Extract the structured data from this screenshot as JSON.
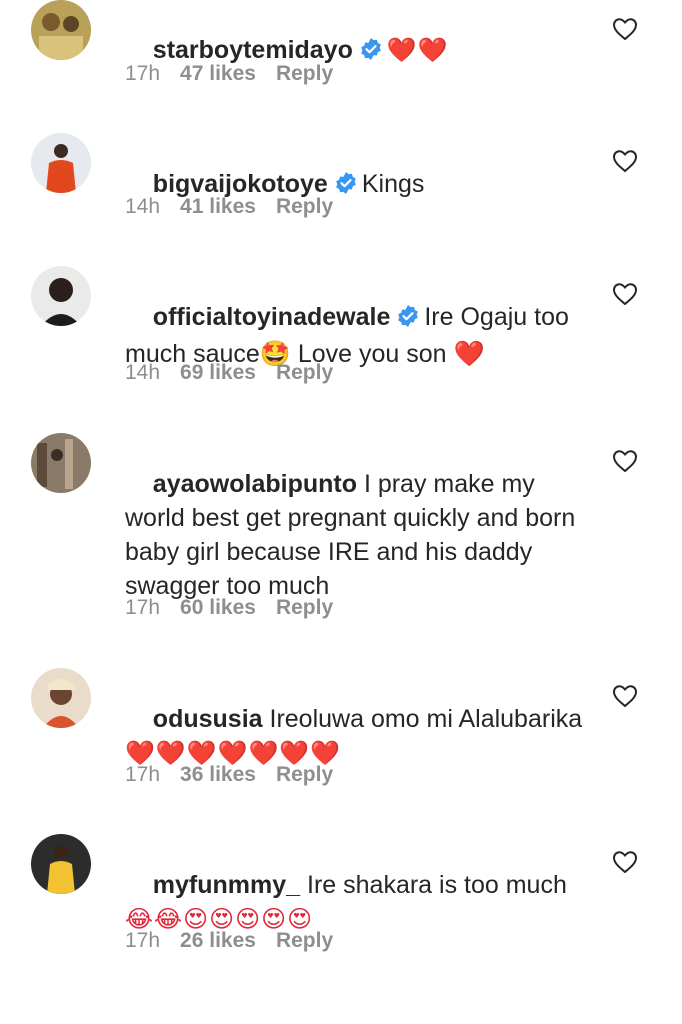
{
  "comments": [
    {
      "username": "starboytemidayo",
      "verified": true,
      "text": "",
      "emoji": "❤️❤️",
      "time": "17h",
      "likes": "47 likes",
      "reply": "Reply",
      "avatar_color": "#b9a15a"
    },
    {
      "username": "bigvaijokotoye",
      "verified": true,
      "text": "Kings",
      "emoji": "",
      "time": "14h",
      "likes": "41 likes",
      "reply": "Reply",
      "avatar_color": "#e6e9ee"
    },
    {
      "username": "officialtoyinadewale",
      "verified": true,
      "text": "Ire Ogaju too much sauce🤩 Love you son ❤️",
      "emoji": "",
      "time": "14h",
      "likes": "69 likes",
      "reply": "Reply",
      "avatar_color": "#2a2a2a"
    },
    {
      "username": "ayaowolabipunto",
      "verified": false,
      "text": "I pray make my world best get pregnant quickly and born baby girl because IRE and his daddy swagger too much",
      "emoji": "",
      "time": "17h",
      "likes": "60 likes",
      "reply": "Reply",
      "avatar_color": "#8a7a68"
    },
    {
      "username": "odususia",
      "verified": false,
      "text": "Ireoluwa omo mi Alalubarika",
      "emoji": "❤️❤️❤️❤️❤️❤️❤️",
      "time": "17h",
      "likes": "36 likes",
      "reply": "Reply",
      "avatar_color": "#e9dccb"
    },
    {
      "username": "myfunmmy_",
      "verified": false,
      "text": "Ire shakara is too much",
      "emoji": "😂😂😍😍😍😍😍",
      "time": "17h",
      "likes": "26 likes",
      "reply": "Reply",
      "avatar_color": "#f2c230"
    }
  ],
  "colors": {
    "text": "#262626",
    "meta": "#8e8e8e",
    "verified": "#3897f0",
    "heart_outline": "#262626",
    "red_heart": "#e0283a"
  },
  "icons": {
    "like": "heart-outline-icon",
    "verified": "verified-badge-icon",
    "avatar": "avatar"
  }
}
